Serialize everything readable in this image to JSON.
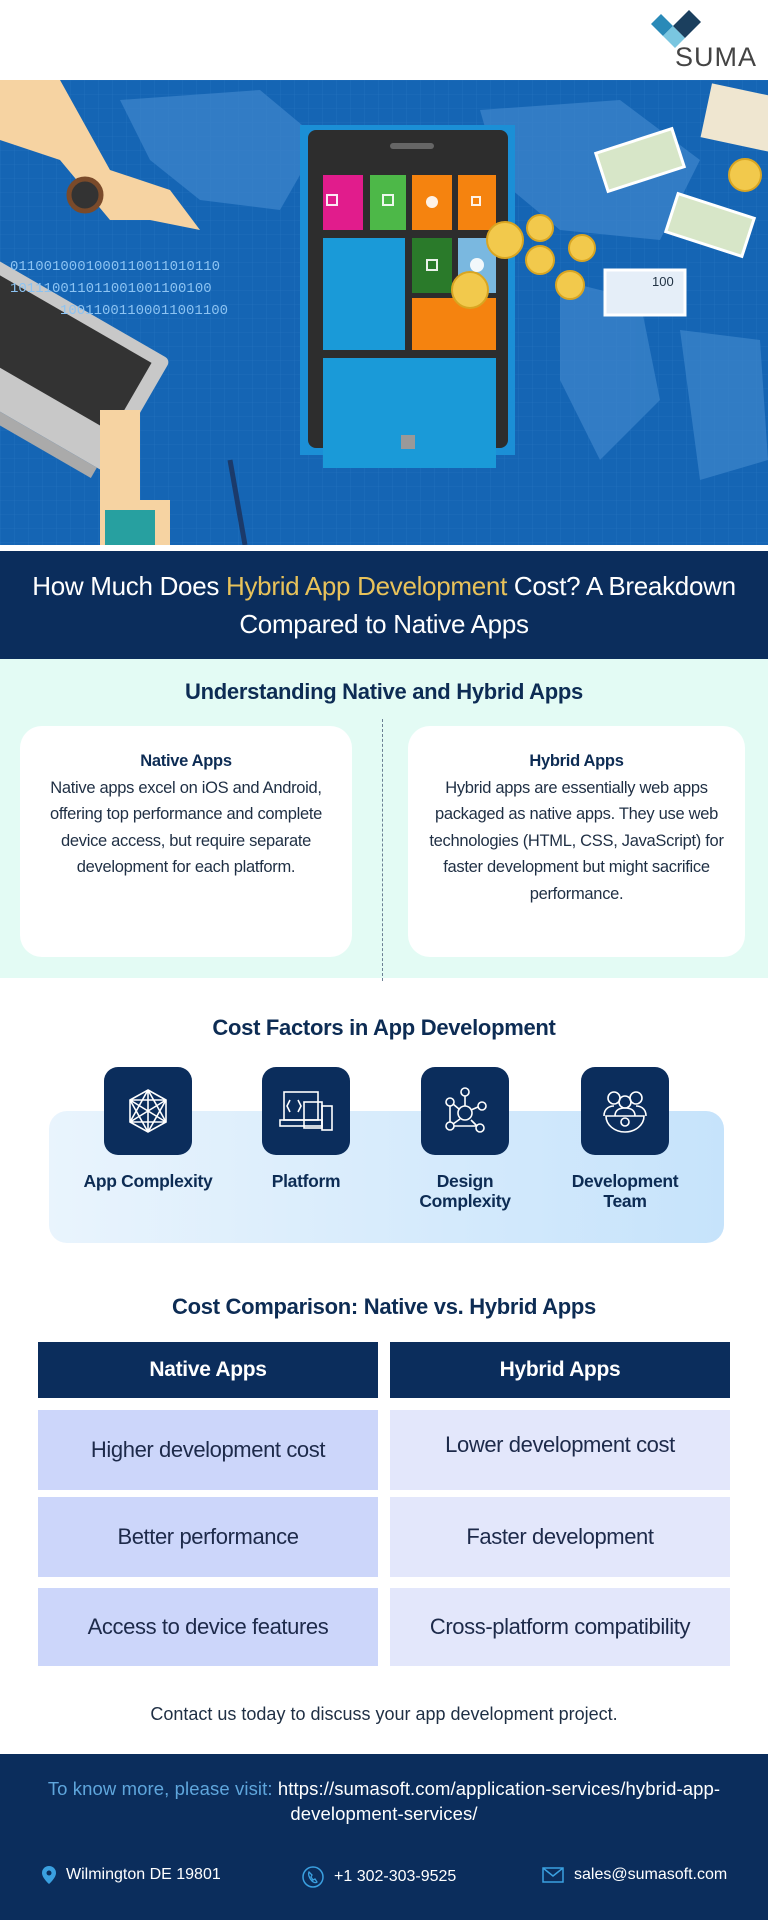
{
  "brand": {
    "logo_text": "SUMA",
    "colors": {
      "navy": "#0b2d5c",
      "accent_gold": "#e8c25a",
      "mint": "#e3fbf4",
      "hero_blue": "#1565b4"
    }
  },
  "hero": {
    "illustration": "smartphone-with-app-tiles-laptop-and-money",
    "note_label": "100"
  },
  "banner": {
    "title_pre": "How Much Does ",
    "title_highlight": "Hybrid App Development",
    "title_post": " Cost? A Breakdown Compared to Native Apps"
  },
  "understanding": {
    "heading": "Understanding Native and Hybrid Apps",
    "native": {
      "title": "Native Apps",
      "body": "Native apps excel on iOS and Android, offering top performance and complete device access, but require separate development for each platform."
    },
    "hybrid": {
      "title": "Hybrid Apps",
      "body": "Hybrid apps are essentially web apps packaged as native apps. They use web technologies (HTML, CSS, JavaScript) for faster development but might sacrifice performance."
    }
  },
  "cost_factors": {
    "heading": "Cost Factors in App Development",
    "items": [
      {
        "label": "App Complexity",
        "icon": "network-icon"
      },
      {
        "label": "Platform",
        "icon": "devices-icon"
      },
      {
        "label": "Design Complexity",
        "icon": "gears-network-icon"
      },
      {
        "label": "Development Team",
        "icon": "team-icon"
      }
    ]
  },
  "comparison": {
    "heading": "Cost Comparison: Native vs. Hybrid Apps",
    "columns": [
      "Native Apps",
      "Hybrid Apps"
    ],
    "rows": [
      [
        "Higher development cost",
        "Lower development cost"
      ],
      [
        "Better performance",
        "Faster development"
      ],
      [
        "Access to device features",
        "Cross-platform compatibility"
      ]
    ]
  },
  "cta": "Contact us today to discuss your app development project.",
  "footer": {
    "visit_label": "To know more, please visit:",
    "visit_url": "https://sumasoft.com/application-services/hybrid-app-development-services/",
    "address": "Wilmington DE 19801",
    "phone": "+1 302-303-9525",
    "email": "sales@sumasoft.com"
  }
}
